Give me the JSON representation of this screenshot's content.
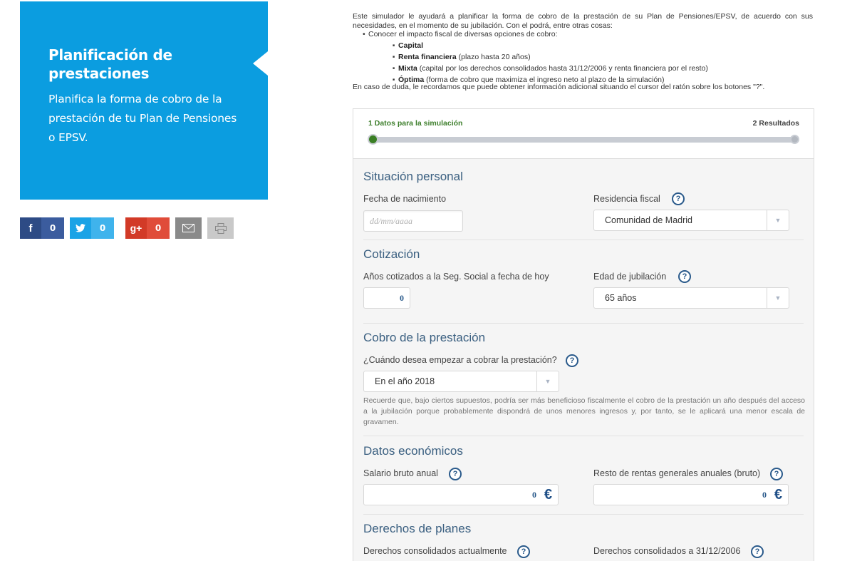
{
  "hero": {
    "title": "Planificación de prestaciones",
    "subtitle": "Planifica la forma de cobro de la prestación de tu Plan de Pensiones o EPSV."
  },
  "social": {
    "facebook_count": "0",
    "twitter_count": "0",
    "googleplus_count": "0"
  },
  "intro": {
    "paragraph": "Este simulador le ayudará a planificar la forma de cobro de la prestación de su Plan de Pensiones/EPSV, de acuerdo con sus necesidades, en el momento de su jubilación. Con el podrá, entre otras cosas:",
    "bullet": "Conocer el impacto fiscal de diversas opciones de cobro:",
    "options": [
      {
        "name": "Capital",
        "desc": ""
      },
      {
        "name": "Renta financiera",
        "desc": " (plazo hasta 20 años)"
      },
      {
        "name": "Mixta",
        "desc": " (capital por los derechos consolidados hasta 31/12/2006 y renta financiera por el resto)"
      },
      {
        "name": "Óptima",
        "desc": " (forma de cobro que maximiza el ingreso neto al plazo de la simulación)"
      }
    ],
    "footer": "En caso de duda, le recordamos que puede obtener información adicional situando el cursor del ratón sobre los botones \"?\"."
  },
  "steps": {
    "step1": "1 Datos para la simulación",
    "step2": "2 Resultados"
  },
  "personal": {
    "title": "Situación personal",
    "birth_label": "Fecha de nacimiento",
    "birth_placeholder": "dd/mm/aaaa",
    "residence_label": "Residencia fiscal",
    "residence_value": "Comunidad de Madrid"
  },
  "cotizacion": {
    "title": "Cotización",
    "years_label": "Años cotizados a la Seg. Social a fecha de hoy",
    "years_value": "0",
    "retire_label": "Edad de jubilación",
    "retire_value": "65 años"
  },
  "cobro": {
    "title": "Cobro de la prestación",
    "when_label": "¿Cuándo desea empezar a cobrar la prestación?",
    "when_value": "En el año 2018",
    "note": "Recuerde que, bajo ciertos supuestos, podría ser más beneficioso fiscalmente el cobro de la prestación un año después del acceso a la jubilación porque probablemente dispondrá de unos menores ingresos y, por tanto, se le aplicará una menor escala de gravamen."
  },
  "economicos": {
    "title": "Datos económicos",
    "salary_label": "Salario bruto anual",
    "salary_value": "0",
    "other_label": "Resto de rentas generales anuales (bruto)",
    "other_value": "0",
    "currency": "€"
  },
  "derechos": {
    "title": "Derechos de planes",
    "current_label": "Derechos consolidados actualmente",
    "dec2006_label": "Derechos consolidados a 31/12/2006"
  },
  "help_symbol": "?",
  "colors": {
    "hero_bg": "#0b9de0",
    "step_active": "#3a7f24",
    "section_title": "#3a5f80",
    "help": "#2a5a8b"
  }
}
